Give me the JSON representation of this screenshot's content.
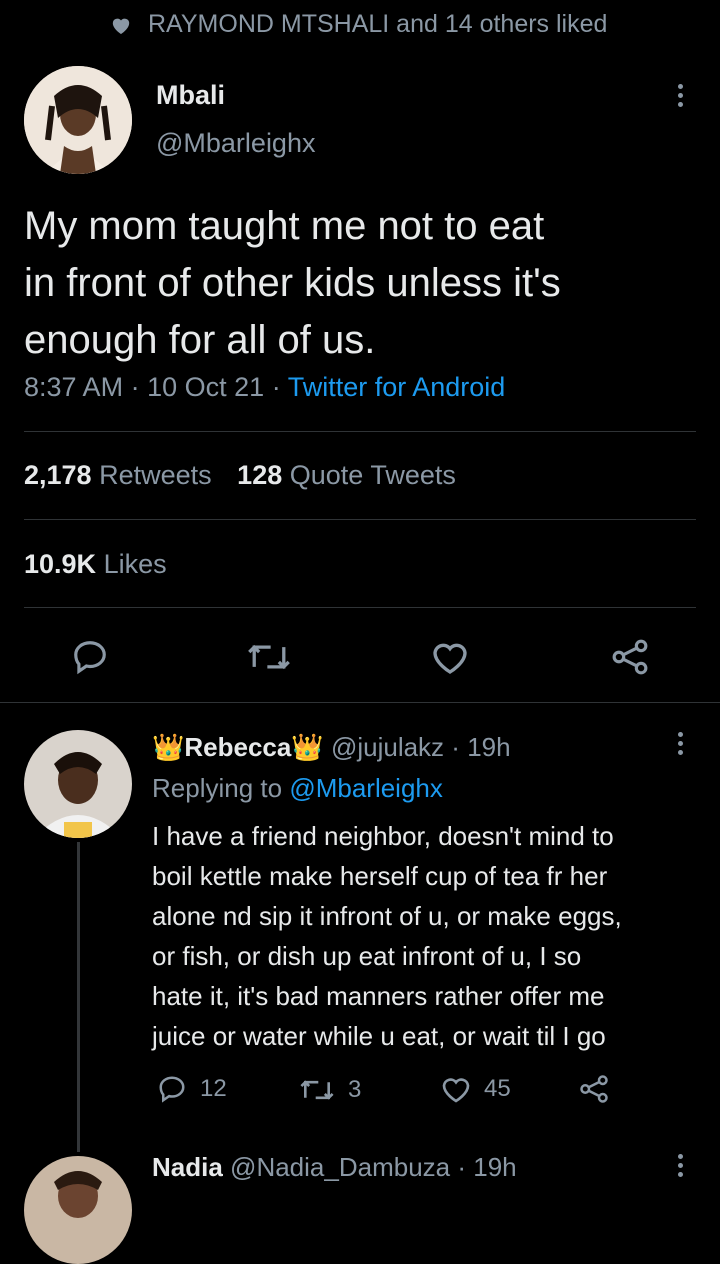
{
  "liked_banner": {
    "text": "RAYMOND MTSHALI and 14 others liked",
    "icon": "heart-filled-icon"
  },
  "tweet": {
    "author_name": "Mbali",
    "author_handle": "@Mbarleighx",
    "text_lines": [
      "My mom taught me not to eat",
      "in front of other kids unless it's",
      "enough for all of us."
    ],
    "time": "8:37 AM",
    "date": "10 Oct 21",
    "source": "Twitter for Android",
    "sep": "·",
    "retweets_count": "2,178",
    "retweets_label": "Retweets",
    "quotes_count": "128",
    "quotes_label": "Quote Tweets",
    "likes_count": "10.9K",
    "likes_label": "Likes",
    "colors": {
      "link": "#1d9bf0",
      "muted": "#8b98a5",
      "divider": "#2f3336"
    }
  },
  "reply1": {
    "crown_left": "👑",
    "author_name": "Rebecca",
    "crown_right": "👑",
    "handle": "@jujulakz",
    "sep": "·",
    "time": "19h",
    "replying_prefix": "Replying to",
    "replying_handle": "@Mbarleighx",
    "text_lines": [
      "I have a friend neighbor, doesn't mind to",
      "boil kettle make herself cup of tea fr her",
      "alone nd sip it infront of u, or make eggs,",
      "or fish, or dish up eat infront of u, I so",
      "hate it, it's bad manners rather offer me",
      "juice or water while u eat, or wait til I go"
    ],
    "replies": "12",
    "retweets": "3",
    "likes": "45"
  },
  "reply2": {
    "author_name": "Nadia",
    "handle": "@Nadia_Dambuza",
    "sep": "·",
    "time": "19h"
  }
}
